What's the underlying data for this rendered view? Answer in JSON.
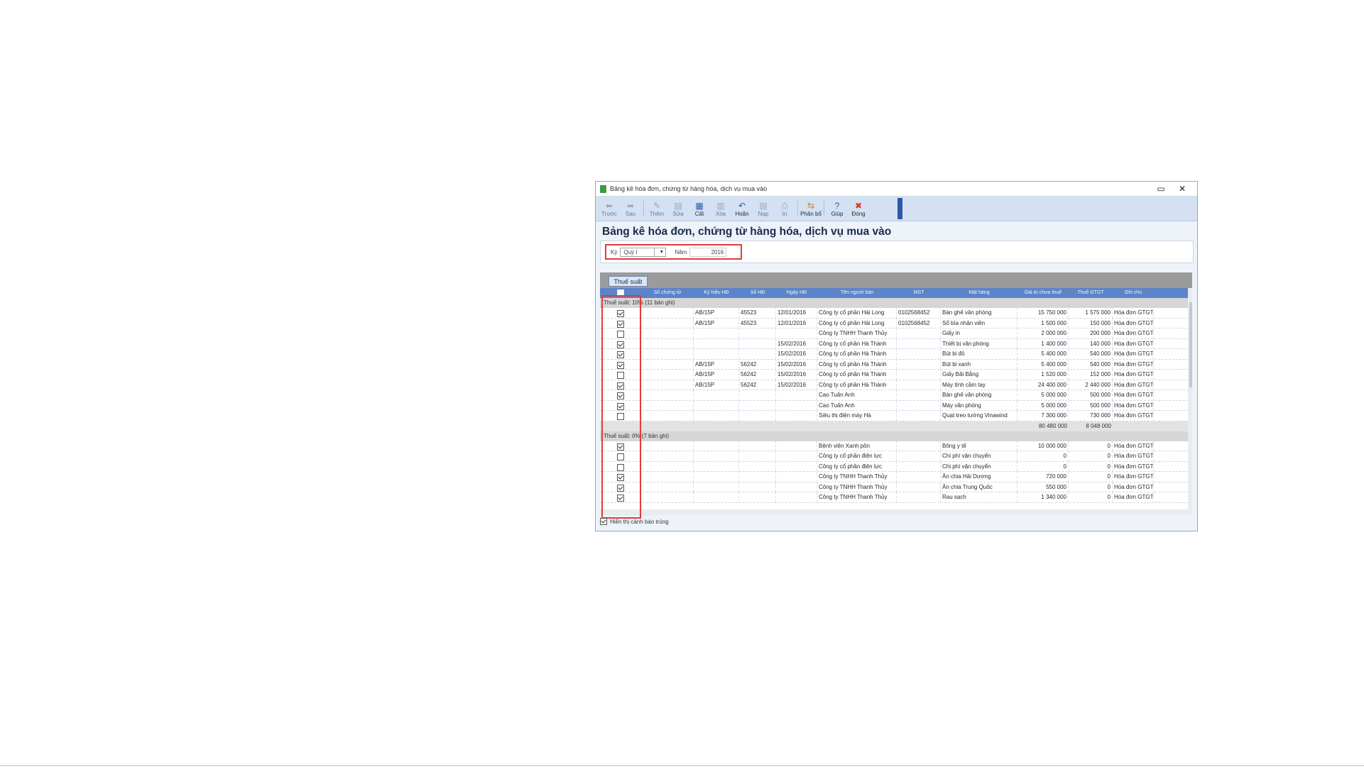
{
  "window": {
    "title": "Bảng kê hóa đơn, chứng từ hàng hóa, dịch vụ mua vào",
    "controls": [
      "▭",
      "✕"
    ]
  },
  "toolbar": [
    {
      "label": "Trước",
      "icon": "back-arrow-icon",
      "glyph": "⬅",
      "state": "disabled"
    },
    {
      "label": "Sau",
      "icon": "forward-arrow-icon",
      "glyph": "➡",
      "state": "disabled"
    },
    {
      "label": "Thêm",
      "icon": "add-icon",
      "glyph": "✎",
      "state": "disabled"
    },
    {
      "label": "Sửa",
      "icon": "edit-icon",
      "glyph": "▤",
      "state": "disabled"
    },
    {
      "label": "Cất",
      "icon": "save-icon",
      "glyph": "▦",
      "state": "active"
    },
    {
      "label": "Xóa",
      "icon": "delete-icon",
      "glyph": "▥",
      "state": "disabled"
    },
    {
      "label": "Hoãn",
      "icon": "undo-icon",
      "glyph": "↶",
      "state": "active"
    },
    {
      "label": "Nạp",
      "icon": "load-icon",
      "glyph": "▤",
      "state": "disabled"
    },
    {
      "label": "In",
      "icon": "print-icon",
      "glyph": "⎙",
      "state": "disabled"
    },
    {
      "label": "Phân bổ",
      "icon": "allocate-icon",
      "glyph": "⇆",
      "state": "orange"
    },
    {
      "label": "Giúp",
      "icon": "help-icon",
      "glyph": "?",
      "state": "active"
    },
    {
      "label": "Đóng",
      "icon": "close-icon",
      "glyph": "✖",
      "state": "red"
    }
  ],
  "heading": "Bảng kê hóa đơn, chứng từ hàng hóa, dịch vụ mua vào",
  "filter": {
    "period_label": "Kỳ",
    "period_value": "Quý I",
    "year_label": "Năm",
    "year_value": "2016"
  },
  "tab_label": "Thuế suất",
  "columns": [
    "",
    "Số chứng từ",
    "Ký hiệu HĐ",
    "Số HĐ",
    "Ngày HĐ",
    "Tên người bán",
    "MST",
    "Mặt hàng",
    "Giá trị chưa thuế",
    "Thuế GTGT",
    "Ghi chú"
  ],
  "groups": [
    {
      "label": "Thuế suất: 10% (11 bản ghi)",
      "rows": [
        {
          "checked": true,
          "so_ct": "",
          "ky_hieu": "AB/15P",
          "so_hd": "45523",
          "ngay": "12/01/2016",
          "ten": "Công ty cổ phần Hải Long",
          "mst": "0102568452",
          "mat_hang": "Bàn ghế văn phòng",
          "gia_tri": "15 750 000",
          "thue": "1 575 000",
          "ghi_chu": "Hóa đơn GTGT"
        },
        {
          "checked": true,
          "so_ct": "",
          "ky_hieu": "AB/15P",
          "so_hd": "45523",
          "ngay": "12/01/2016",
          "ten": "Công ty cổ phần Hải Long",
          "mst": "0102568452",
          "mat_hang": "Sổ bìa nhân viên",
          "gia_tri": "1 500 000",
          "thue": "150 000",
          "ghi_chu": "Hóa đơn GTGT"
        },
        {
          "checked": false,
          "so_ct": "",
          "ky_hieu": "",
          "so_hd": "",
          "ngay": "",
          "ten": "Công ty TNHH Thanh Thủy",
          "mst": "",
          "mat_hang": "Giấy in",
          "gia_tri": "2 000 000",
          "thue": "200 000",
          "ghi_chu": "Hóa đơn GTGT"
        },
        {
          "checked": true,
          "so_ct": "",
          "ky_hieu": "",
          "so_hd": "",
          "ngay": "15/02/2016",
          "ten": "Công ty cổ phần Hà Thành",
          "mst": "",
          "mat_hang": "Thiết bị văn phòng",
          "gia_tri": "1 400 000",
          "thue": "140 000",
          "ghi_chu": "Hóa đơn GTGT"
        },
        {
          "checked": true,
          "so_ct": "",
          "ky_hieu": "",
          "so_hd": "",
          "ngay": "15/02/2016",
          "ten": "Công ty cổ phần Hà Thành",
          "mst": "",
          "mat_hang": "Bút bi đỏ",
          "gia_tri": "5 400 000",
          "thue": "540 000",
          "ghi_chu": "Hóa đơn GTGT"
        },
        {
          "checked": true,
          "so_ct": "",
          "ky_hieu": "AB/15P",
          "so_hd": "56242",
          "ngay": "15/02/2016",
          "ten": "Công ty cổ phần Hà Thành",
          "mst": "",
          "mat_hang": "Bút bi xanh",
          "gia_tri": "5 400 000",
          "thue": "540 000",
          "ghi_chu": "Hóa đơn GTGT"
        },
        {
          "checked": false,
          "so_ct": "",
          "ky_hieu": "AB/15P",
          "so_hd": "56242",
          "ngay": "15/02/2016",
          "ten": "Công ty cổ phần Hà Thành",
          "mst": "",
          "mat_hang": "Giấy Bãi Bằng",
          "gia_tri": "1 520 000",
          "thue": "152 000",
          "ghi_chu": "Hóa đơn GTGT"
        },
        {
          "checked": true,
          "so_ct": "",
          "ky_hieu": "AB/15P",
          "so_hd": "56242",
          "ngay": "15/02/2016",
          "ten": "Công ty cổ phần Hà Thành",
          "mst": "",
          "mat_hang": "Máy tính cầm tay",
          "gia_tri": "24 400 000",
          "thue": "2 440 000",
          "ghi_chu": "Hóa đơn GTGT"
        },
        {
          "checked": true,
          "so_ct": "",
          "ky_hieu": "",
          "so_hd": "",
          "ngay": "",
          "ten": "Cao Tuấn Anh",
          "mst": "",
          "mat_hang": "Bàn ghế văn phòng",
          "gia_tri": "5 000 000",
          "thue": "500 000",
          "ghi_chu": "Hóa đơn GTGT"
        },
        {
          "checked": true,
          "so_ct": "",
          "ky_hieu": "",
          "so_hd": "",
          "ngay": "",
          "ten": "Cao Tuấn Anh",
          "mst": "",
          "mat_hang": "Máy văn phòng",
          "gia_tri": "5 000 000",
          "thue": "500 000",
          "ghi_chu": "Hóa đơn GTGT"
        },
        {
          "checked": false,
          "so_ct": "",
          "ky_hieu": "",
          "so_hd": "",
          "ngay": "",
          "ten": "Siêu thị điện máy Hà",
          "mst": "",
          "mat_hang": "Quạt treo tường Vinawind",
          "gia_tri": "7 300 000",
          "thue": "730 000",
          "ghi_chu": "Hóa đơn GTGT"
        }
      ],
      "sum_gia_tri": "80 480 000",
      "sum_thue": "8 048 000"
    },
    {
      "label": "Thuế suất: 0% (7 bản ghi)",
      "rows": [
        {
          "checked": true,
          "so_ct": "",
          "ky_hieu": "",
          "so_hd": "",
          "ngay": "",
          "ten": "Bệnh viện Xanh pôn",
          "mst": "",
          "mat_hang": "Bông y tế",
          "gia_tri": "10 000 000",
          "thue": "0",
          "ghi_chu": "Hóa đơn GTGT"
        },
        {
          "checked": false,
          "so_ct": "",
          "ky_hieu": "",
          "so_hd": "",
          "ngay": "",
          "ten": "Công ty cổ phần điện lực",
          "mst": "",
          "mat_hang": "Chi phí vận chuyển",
          "gia_tri": "0",
          "thue": "0",
          "ghi_chu": "Hóa đơn GTGT"
        },
        {
          "checked": false,
          "so_ct": "",
          "ky_hieu": "",
          "so_hd": "",
          "ngay": "",
          "ten": "Công ty cổ phần điện lực",
          "mst": "",
          "mat_hang": "Chi phí vận chuyển",
          "gia_tri": "0",
          "thue": "0",
          "ghi_chu": "Hóa đơn GTGT"
        },
        {
          "checked": true,
          "so_ct": "",
          "ky_hieu": "",
          "so_hd": "",
          "ngay": "",
          "ten": "Công ty TNHH Thanh Thủy",
          "mst": "",
          "mat_hang": "Ăn chia Hải Dương",
          "gia_tri": "720 000",
          "thue": "0",
          "ghi_chu": "Hóa đơn GTGT"
        },
        {
          "checked": true,
          "so_ct": "",
          "ky_hieu": "",
          "so_hd": "",
          "ngay": "",
          "ten": "Công ty TNHH Thanh Thủy",
          "mst": "",
          "mat_hang": "Ăn chia Trung Quốc",
          "gia_tri": "550 000",
          "thue": "0",
          "ghi_chu": "Hóa đơn GTGT"
        },
        {
          "checked": true,
          "so_ct": "",
          "ky_hieu": "",
          "so_hd": "",
          "ngay": "",
          "ten": "Công ty TNHH Thanh Thủy",
          "mst": "",
          "mat_hang": "Rau sạch",
          "gia_tri": "1 340 000",
          "thue": "0",
          "ghi_chu": "Hóa đơn GTGT"
        }
      ]
    }
  ],
  "footer_checkbox_label": "Hiển thị cảnh báo trùng"
}
